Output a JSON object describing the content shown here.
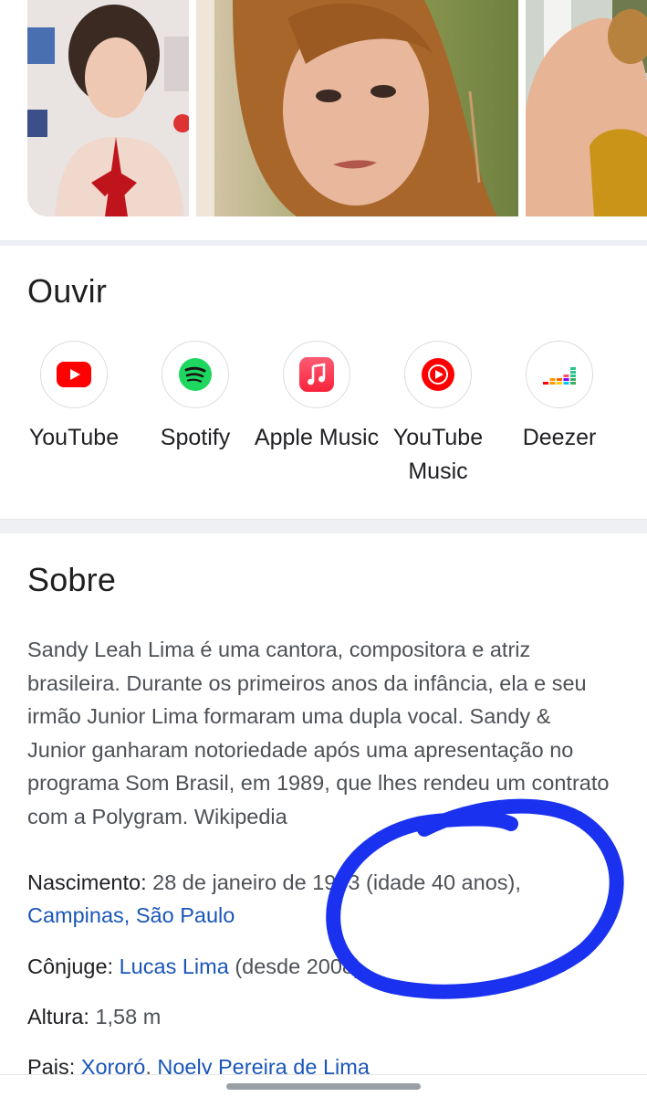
{
  "listen": {
    "title": "Ouvir",
    "services": [
      {
        "name": "YouTube",
        "icon": "youtube-icon",
        "color": "#ff0000"
      },
      {
        "name": "Spotify",
        "icon": "spotify-icon",
        "color": "#1ed760"
      },
      {
        "name": "Apple Music",
        "icon": "apple-music-icon",
        "color": "#fa2d48"
      },
      {
        "name": "YouTube Music",
        "icon": "youtube-music-icon",
        "color": "#ff0000"
      },
      {
        "name": "Deezer",
        "icon": "deezer-icon",
        "color": "#a238ff"
      }
    ]
  },
  "about": {
    "title": "Sobre",
    "description": "Sandy Leah Lima é uma cantora, compositora e atriz brasileira. Durante os primeiros anos da infância, ela e seu irmão Junior Lima formaram uma dupla vocal. Sandy & Junior ganharam notoriedade após uma apresentação no programa Som Brasil, em 1989, que lhes rendeu um contrato com a Polygram. Wikipedia"
  },
  "facts": {
    "birth": {
      "label": "Nascimento:",
      "value": "28 de janeiro de 1983 (idade 40 anos),",
      "place": "Campinas, São Paulo"
    },
    "spouse": {
      "label": "Cônjuge:",
      "name": "Lucas Lima",
      "since": "(desde 2008)"
    },
    "height": {
      "label": "Altura:",
      "value": "1,58 m"
    },
    "parents": {
      "label": "Pais:",
      "value1": "Xororó",
      "value2": "Noely Pereira de Lima"
    }
  },
  "colors": {
    "link": "#1a56b8",
    "annotation": "#1a32f0"
  }
}
